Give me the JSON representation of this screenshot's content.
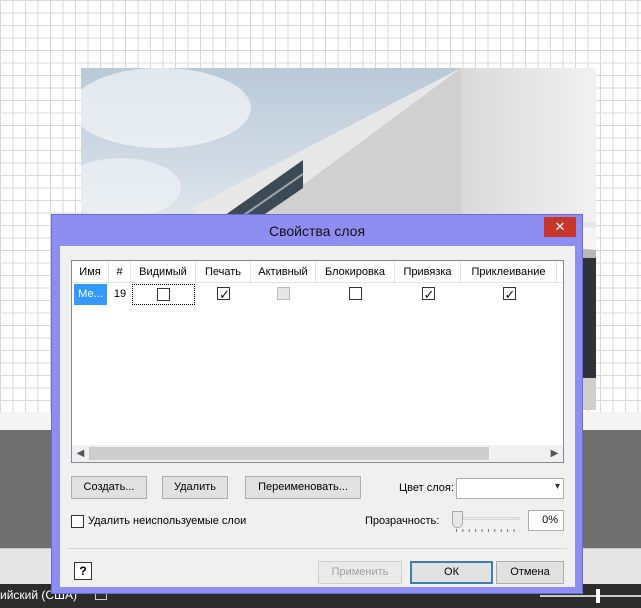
{
  "dialog": {
    "title": "Свойства слоя",
    "close_glyph": "✕",
    "columns": [
      "Имя",
      "#",
      "Видимый",
      "Печать",
      "Активный",
      "Блокировка",
      "Привязка",
      "Приклеивание"
    ],
    "row": {
      "name": "Ме...",
      "number": "19",
      "visible": false,
      "print": true,
      "active": "disabled",
      "lock": false,
      "snap": true,
      "glue": true
    },
    "scroll_left": "◀",
    "scroll_right": "▶",
    "buttons": {
      "create": "Создать...",
      "delete": "Удалить",
      "rename": "Переименовать...",
      "apply": "Применить",
      "ok": "ОК",
      "cancel": "Отмена"
    },
    "layer_color_label": "Цвет слоя:",
    "layer_color_value": "",
    "remove_unused_label": "Удалить неиспользуемые слои",
    "remove_unused_checked": false,
    "transparency_label": "Прозрачность:",
    "transparency_value": "0%",
    "help_glyph": "?",
    "dropdown_glyph": "▾"
  },
  "statusbar": {
    "language": "ийский (США)"
  },
  "colors": {
    "dialog_frame": "#8e8ef2",
    "close_button": "#c7352b",
    "selection": "#3399ff"
  }
}
